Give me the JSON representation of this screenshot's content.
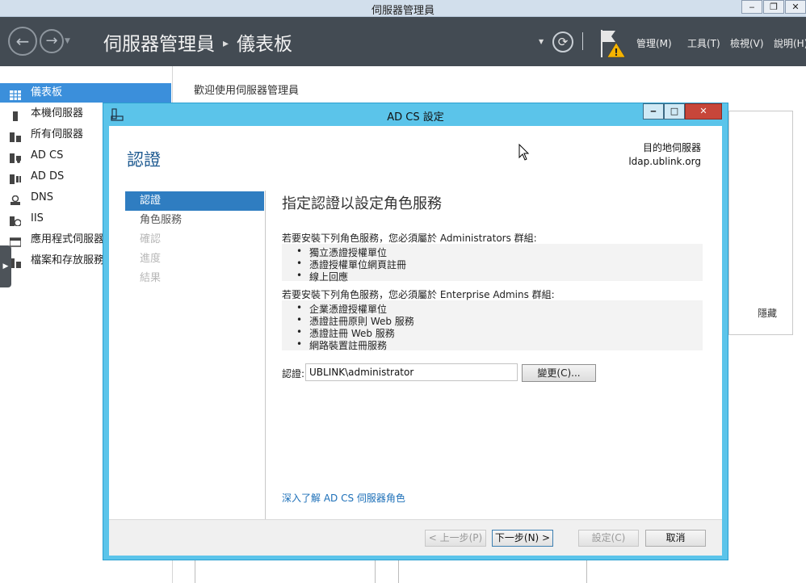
{
  "app": {
    "window_title": "伺服器管理員",
    "breadcrumb": [
      "伺服器管理員",
      "儀表板"
    ],
    "menu": [
      "管理(M)",
      "工具(T)",
      "檢視(V)",
      "說明(H)"
    ],
    "window_buttons": [
      "‒",
      "❐",
      "✕"
    ]
  },
  "sidebar": {
    "items": [
      {
        "label": "儀表板",
        "icon": "dashboard-icon",
        "selected": true
      },
      {
        "label": "本機伺服器",
        "icon": "server-icon"
      },
      {
        "label": "所有伺服器",
        "icon": "servers-icon"
      },
      {
        "label": "AD CS",
        "icon": "adcs-icon"
      },
      {
        "label": "AD DS",
        "icon": "adds-icon"
      },
      {
        "label": "DNS",
        "icon": "dns-icon"
      },
      {
        "label": "IIS",
        "icon": "iis-icon"
      },
      {
        "label": "應用程式伺服器",
        "icon": "app-server-icon"
      },
      {
        "label": "檔案和存放服務",
        "icon": "file-storage-icon"
      }
    ]
  },
  "main": {
    "welcome": "歡迎使用伺服器管理員",
    "hide": "隱藏"
  },
  "dialog": {
    "title": "AD CS 設定",
    "heading": "認證",
    "target_label": "目的地伺服器",
    "target_value": "ldap.ublink.org",
    "steps": [
      {
        "label": "認證",
        "state": "selected"
      },
      {
        "label": "角色服務",
        "state": "normal"
      },
      {
        "label": "確認",
        "state": "disabled"
      },
      {
        "label": "進度",
        "state": "disabled"
      },
      {
        "label": "結果",
        "state": "disabled"
      }
    ],
    "page_title": "指定認證以設定角色服務",
    "admins_text": "若要安裝下列角色服務，您必須屬於 Administrators 群組:",
    "admins_list": [
      "獨立憑證授權單位",
      "憑證授權單位網頁註冊",
      "線上回應"
    ],
    "enterprise_text": "若要安裝下列角色服務，您必須屬於 Enterprise Admins 群組:",
    "enterprise_list": [
      "企業憑證授權單位",
      "憑證註冊原則 Web 服務",
      "憑證註冊 Web 服務",
      "網路裝置註冊服務"
    ],
    "credential_label": "認證:",
    "credential_value": "UBLINK\\administrator",
    "change_button": "變更(C)...",
    "learn_more": "深入了解 AD CS 伺服器角色",
    "buttons": {
      "prev": "< 上一步(P)",
      "next": "下一步(N) >",
      "configure": "設定(C)",
      "cancel": "取消"
    },
    "title_buttons": [
      "‒",
      "□",
      "✕"
    ]
  },
  "colors": {
    "toolbar": "#434b53",
    "nav_selected": "#3b8fdb",
    "dialog_frame": "#5bc4ea",
    "close_button": "#c7463a",
    "heading": "#1e5a90"
  }
}
